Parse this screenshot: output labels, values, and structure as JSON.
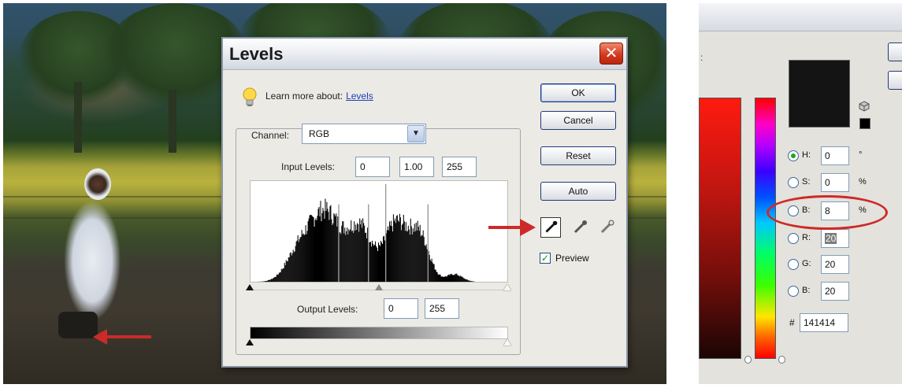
{
  "dialog": {
    "title": "Levels",
    "close_glyph": "✕",
    "learn_more_prefix": "Learn more about:",
    "learn_more_link": "Levels",
    "channel_label": "Channel:",
    "channel_value": "RGB",
    "input_levels_label": "Input Levels:",
    "input_levels": [
      "0",
      "1.00",
      "255"
    ],
    "output_levels_label": "Output Levels:",
    "output_levels": [
      "0",
      "255"
    ],
    "buttons": {
      "ok": "OK",
      "cancel": "Cancel",
      "reset": "Reset",
      "auto": "Auto"
    },
    "preview_label": "Preview",
    "preview_checked": true,
    "dropdown_glyph": "▼"
  },
  "color_picker": {
    "fields": [
      {
        "label": "H:",
        "value": "0",
        "unit": "°",
        "selected": true
      },
      {
        "label": "S:",
        "value": "0",
        "unit": "%",
        "selected": false
      },
      {
        "label": "B:",
        "value": "8",
        "unit": "%",
        "selected": false
      },
      {
        "label": "R:",
        "value": "20",
        "unit": "",
        "selected": false
      },
      {
        "label": "G:",
        "value": "20",
        "unit": "",
        "selected": false
      },
      {
        "label": "B:",
        "value": "20",
        "unit": "",
        "selected": false
      }
    ],
    "hex_label": "#",
    "hex_value": "141414",
    "current_color": "#141414"
  },
  "colors": {
    "annotation_red": "#cc2a28",
    "link_blue": "#1a3fb8",
    "button_border": "#1f3a78"
  },
  "icons": [
    "lightbulb-icon",
    "close-icon",
    "chevron-down-icon",
    "black-eyedropper-icon",
    "gray-eyedropper-icon",
    "white-eyedropper-icon",
    "checkmark-icon",
    "cube-icon"
  ]
}
